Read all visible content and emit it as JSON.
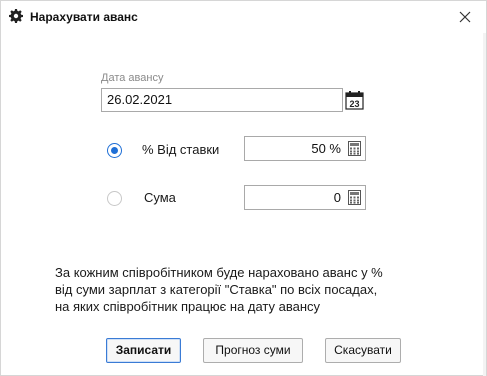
{
  "window": {
    "title": "Нарахувати аванс",
    "title_icon": "gear-icon",
    "close_glyph": "✕"
  },
  "date": {
    "label": "Дата авансу",
    "value": "26.02.2021",
    "calendar_day": "23"
  },
  "options": {
    "rate": {
      "label": "% Від ставки",
      "value": "50 %",
      "selected": true
    },
    "sum": {
      "label": "Сума",
      "value": "0",
      "selected": false
    }
  },
  "info": {
    "lines": [
      "За кожним співробітником буде нараховано аванс у %",
      "від суми зарплат з категорії \"Ставка\" по всіх посадах,",
      "на яких співробітник працює на дату авансу"
    ]
  },
  "buttons": {
    "save": "Записати",
    "forecast": "Прогноз суми",
    "cancel": "Скасувати"
  },
  "colors": {
    "accent": "#1f6fd6",
    "border": "#a9a9a9",
    "label_muted": "#8a8a8a"
  }
}
